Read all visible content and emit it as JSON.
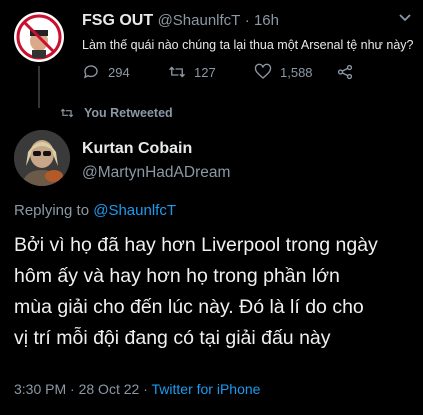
{
  "parent": {
    "display_name": "FSG OUT",
    "handle": "@ShaunlfcT",
    "age": "16h",
    "text": "Làm thế quái nào chúng ta lại thua một Arsenal tệ như này?",
    "actions": {
      "reply_count": "294",
      "retweet_count": "127",
      "like_count": "1,588"
    },
    "avatar_text": "FSG OUT"
  },
  "retweet_label": "You Retweeted",
  "tweet": {
    "display_name": "Kurtan Cobain",
    "handle": "@MartynHadADream",
    "replying_to_prefix": "Replying to",
    "replying_to": "@ShaunlfcT",
    "lines": [
      "Bởi vì họ đã hay hơn Liverpool trong ngày",
      "hôm ấy và hay hơn họ trong phần lớn",
      "mùa giải cho đến lúc này. Đó là lí do cho",
      "vị trí mỗi đội đang có tại giải đấu này"
    ],
    "time": "3:30 PM",
    "date": "28 Oct 22",
    "separator": "·",
    "source": "Twitter for iPhone"
  },
  "colors": {
    "background": "#000000",
    "link": "#1d9bf0",
    "muted": "#8b98a5",
    "text": "#e7e9ea"
  }
}
